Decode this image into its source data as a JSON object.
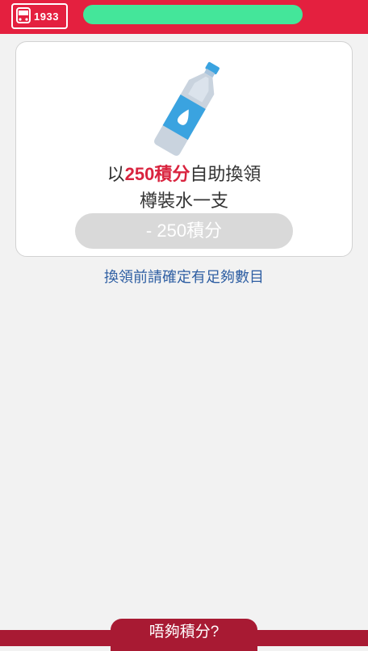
{
  "header": {
    "logo_text": "1933",
    "logo_icon": "bus-icon",
    "username_masked": true,
    "colors": {
      "header_bg": "#e4203f",
      "mask": "#44e69a"
    }
  },
  "offer": {
    "icon": "water-bottle-icon",
    "prefix": "以",
    "points_highlight": "250積分",
    "suffix": "自助換領",
    "item": "樽裝水一支",
    "button_label": "- 250積分",
    "button_enabled": false,
    "colors": {
      "highlight": "#d9243f",
      "button_disabled": "#d9d9d9"
    }
  },
  "note": "換領前請確定有足夠數目",
  "footer": {
    "tab_label": "唔夠積分?",
    "colors": {
      "bar": "#a81a33"
    }
  }
}
